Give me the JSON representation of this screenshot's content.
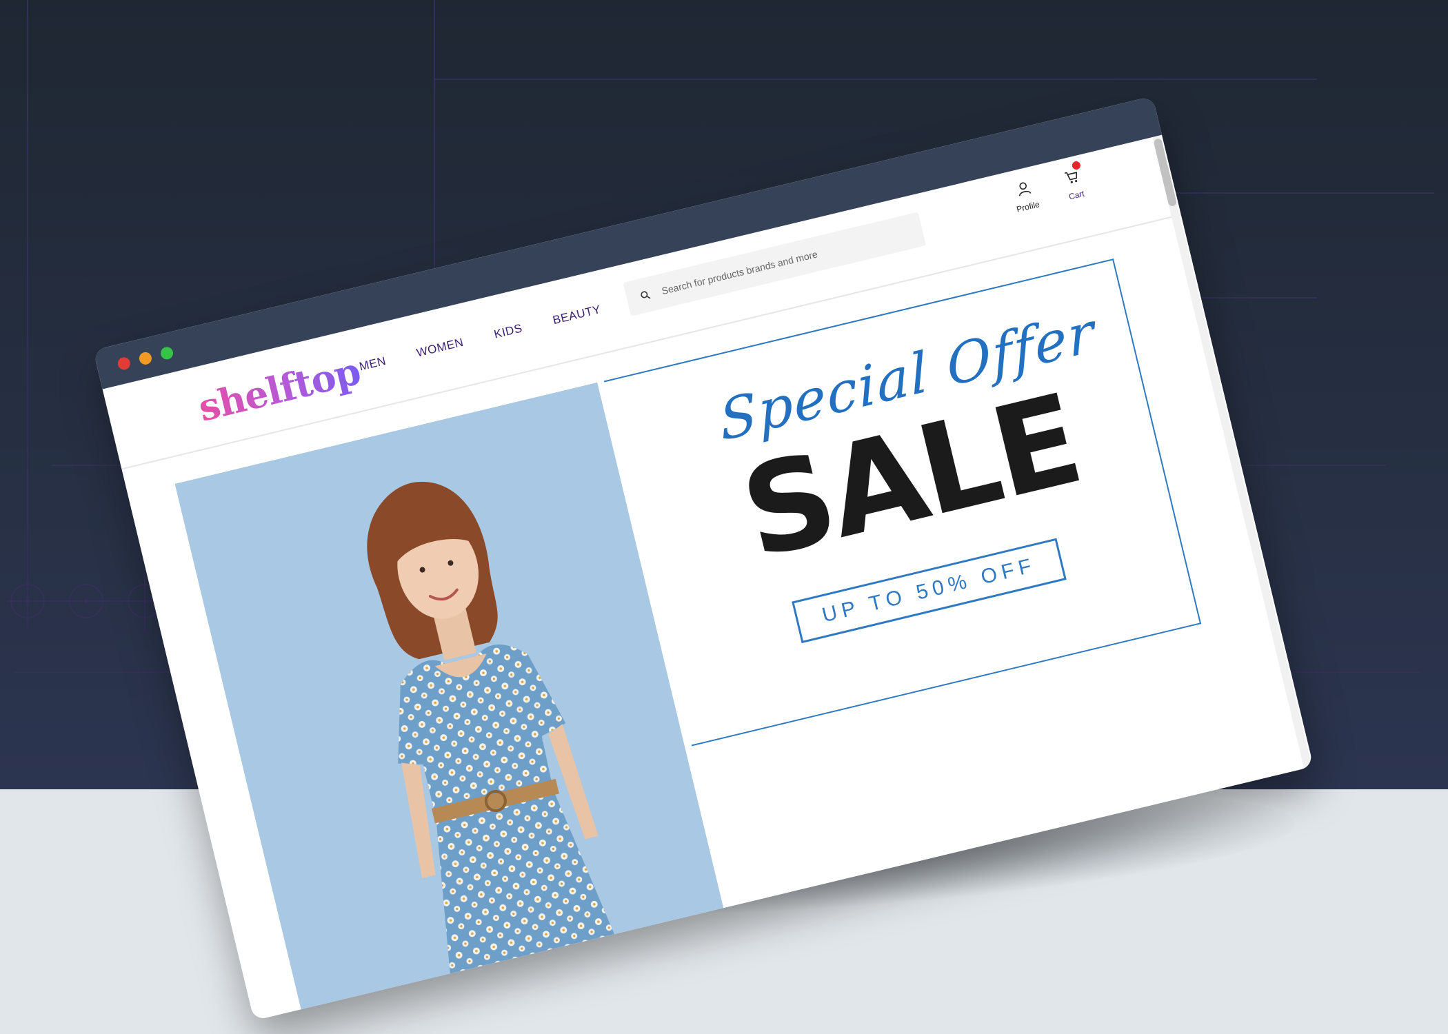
{
  "window": {
    "controls": [
      "close",
      "minimize",
      "maximize"
    ]
  },
  "brand": {
    "logo_text": "shelftop",
    "nav_color": "#3b1f74",
    "accent_blue": "#2e79c2",
    "hero_bg": "#a9c8e3"
  },
  "nav": {
    "items": [
      {
        "label": "MEN"
      },
      {
        "label": "WOMEN"
      },
      {
        "label": "KIDS"
      },
      {
        "label": "BEAUTY"
      }
    ]
  },
  "search": {
    "placeholder": "Search for products brands and more",
    "icon": "search-icon"
  },
  "header_actions": {
    "profile_label": "Profile",
    "profile_icon": "user-icon",
    "cart_label": "Cart",
    "cart_icon": "cart-icon"
  },
  "hero": {
    "script_text": "Special Offer",
    "headline": "SALE",
    "discount": "UP TO 50% OFF"
  }
}
